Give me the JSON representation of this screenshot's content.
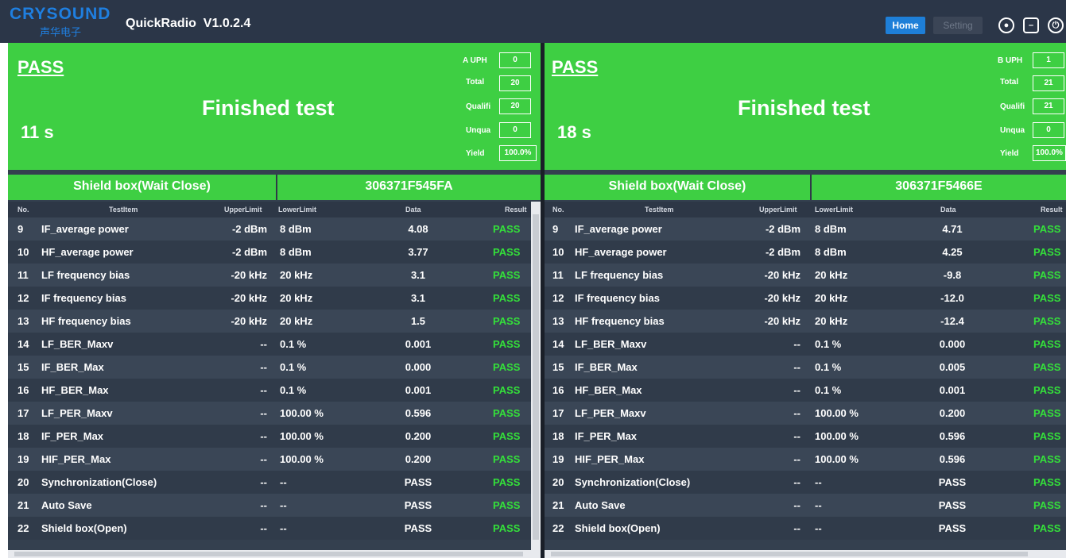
{
  "app": {
    "logo_text": "CRYSOUND",
    "logo_cn": "声华电子",
    "title": "QuickRadio  V1.0.2.4",
    "home_label": "Home",
    "setting_label": "Setting",
    "user_icon": "user-icon",
    "minimize_icon": "minimize-icon",
    "power_icon": "power-icon",
    "accent_color": "#1e7fd8",
    "pass_color": "#3ecf43"
  },
  "headers": {
    "no": "No.",
    "item": "TestItem",
    "upper": "UpperLimit",
    "lower": "LowerLimit",
    "data": "Data",
    "result": "Result"
  },
  "left": {
    "status": "PASS",
    "time": "11 s",
    "message": "Finished test",
    "stats": [
      {
        "label": "A UPH",
        "value": "0"
      },
      {
        "label": "Total",
        "value": "20"
      },
      {
        "label": "Qualifi",
        "value": "20"
      },
      {
        "label": "Unqua",
        "value": "0"
      },
      {
        "label": "Yield",
        "value": "100.0%"
      }
    ],
    "box_status": "Shield box(Wait Close)",
    "serial": "306371F545FA",
    "rows": [
      {
        "no": "9",
        "item": "IF_average power",
        "upper": "-2 dBm",
        "lower": "8 dBm",
        "data": "4.08",
        "result": "PASS"
      },
      {
        "no": "10",
        "item": "HF_average power",
        "upper": "-2 dBm",
        "lower": "8 dBm",
        "data": "3.77",
        "result": "PASS"
      },
      {
        "no": "11",
        "item": "LF frequency bias",
        "upper": "-20 kHz",
        "lower": "20 kHz",
        "data": "3.1",
        "result": "PASS"
      },
      {
        "no": "12",
        "item": "IF frequency bias",
        "upper": "-20 kHz",
        "lower": "20 kHz",
        "data": "3.1",
        "result": "PASS"
      },
      {
        "no": "13",
        "item": "HF frequency bias",
        "upper": "-20 kHz",
        "lower": "20 kHz",
        "data": "1.5",
        "result": "PASS"
      },
      {
        "no": "14",
        "item": "LF_BER_Maxv",
        "upper": "--",
        "lower": "0.1 %",
        "data": "0.001",
        "result": "PASS"
      },
      {
        "no": "15",
        "item": "IF_BER_Max",
        "upper": "--",
        "lower": "0.1 %",
        "data": "0.000",
        "result": "PASS"
      },
      {
        "no": "16",
        "item": "HF_BER_Max",
        "upper": "--",
        "lower": "0.1 %",
        "data": "0.001",
        "result": "PASS"
      },
      {
        "no": "17",
        "item": "LF_PER_Maxv",
        "upper": "--",
        "lower": "100.00 %",
        "data": "0.596",
        "result": "PASS"
      },
      {
        "no": "18",
        "item": "IF_PER_Max",
        "upper": "--",
        "lower": "100.00 %",
        "data": "0.200",
        "result": "PASS"
      },
      {
        "no": "19",
        "item": "HIF_PER_Max",
        "upper": "--",
        "lower": "100.00 %",
        "data": "0.200",
        "result": "PASS"
      },
      {
        "no": "20",
        "item": "Synchronization(Close)",
        "upper": "--",
        "lower": "--",
        "data": "PASS",
        "result": "PASS"
      },
      {
        "no": "21",
        "item": "Auto Save",
        "upper": "--",
        "lower": "--",
        "data": "PASS",
        "result": "PASS"
      },
      {
        "no": "22",
        "item": "Shield box(Open)",
        "upper": "--",
        "lower": "--",
        "data": "PASS",
        "result": "PASS"
      }
    ]
  },
  "right": {
    "status": "PASS",
    "time": "18 s",
    "message": "Finished test",
    "stats": [
      {
        "label": "B UPH",
        "value": "1"
      },
      {
        "label": "Total",
        "value": "21"
      },
      {
        "label": "Qualifi",
        "value": "21"
      },
      {
        "label": "Unqua",
        "value": "0"
      },
      {
        "label": "Yield",
        "value": "100.0%"
      }
    ],
    "box_status": "Shield box(Wait Close)",
    "serial": "306371F5466E",
    "rows": [
      {
        "no": "9",
        "item": "IF_average power",
        "upper": "-2 dBm",
        "lower": "8 dBm",
        "data": "4.71",
        "result": "PASS"
      },
      {
        "no": "10",
        "item": "HF_average power",
        "upper": "-2 dBm",
        "lower": "8 dBm",
        "data": "4.25",
        "result": "PASS"
      },
      {
        "no": "11",
        "item": "LF frequency bias",
        "upper": "-20 kHz",
        "lower": "20 kHz",
        "data": "-9.8",
        "result": "PASS"
      },
      {
        "no": "12",
        "item": "IF frequency bias",
        "upper": "-20 kHz",
        "lower": "20 kHz",
        "data": "-12.0",
        "result": "PASS"
      },
      {
        "no": "13",
        "item": "HF frequency bias",
        "upper": "-20 kHz",
        "lower": "20 kHz",
        "data": "-12.4",
        "result": "PASS"
      },
      {
        "no": "14",
        "item": "LF_BER_Maxv",
        "upper": "--",
        "lower": "0.1 %",
        "data": "0.000",
        "result": "PASS"
      },
      {
        "no": "15",
        "item": "IF_BER_Max",
        "upper": "--",
        "lower": "0.1 %",
        "data": "0.005",
        "result": "PASS"
      },
      {
        "no": "16",
        "item": "HF_BER_Max",
        "upper": "--",
        "lower": "0.1 %",
        "data": "0.001",
        "result": "PASS"
      },
      {
        "no": "17",
        "item": "LF_PER_Maxv",
        "upper": "--",
        "lower": "100.00 %",
        "data": "0.200",
        "result": "PASS"
      },
      {
        "no": "18",
        "item": "IF_PER_Max",
        "upper": "--",
        "lower": "100.00 %",
        "data": "0.596",
        "result": "PASS"
      },
      {
        "no": "19",
        "item": "HIF_PER_Max",
        "upper": "--",
        "lower": "100.00 %",
        "data": "0.596",
        "result": "PASS"
      },
      {
        "no": "20",
        "item": "Synchronization(Close)",
        "upper": "--",
        "lower": "--",
        "data": "PASS",
        "result": "PASS"
      },
      {
        "no": "21",
        "item": "Auto Save",
        "upper": "--",
        "lower": "--",
        "data": "PASS",
        "result": "PASS"
      },
      {
        "no": "22",
        "item": "Shield box(Open)",
        "upper": "--",
        "lower": "--",
        "data": "PASS",
        "result": "PASS"
      }
    ]
  }
}
